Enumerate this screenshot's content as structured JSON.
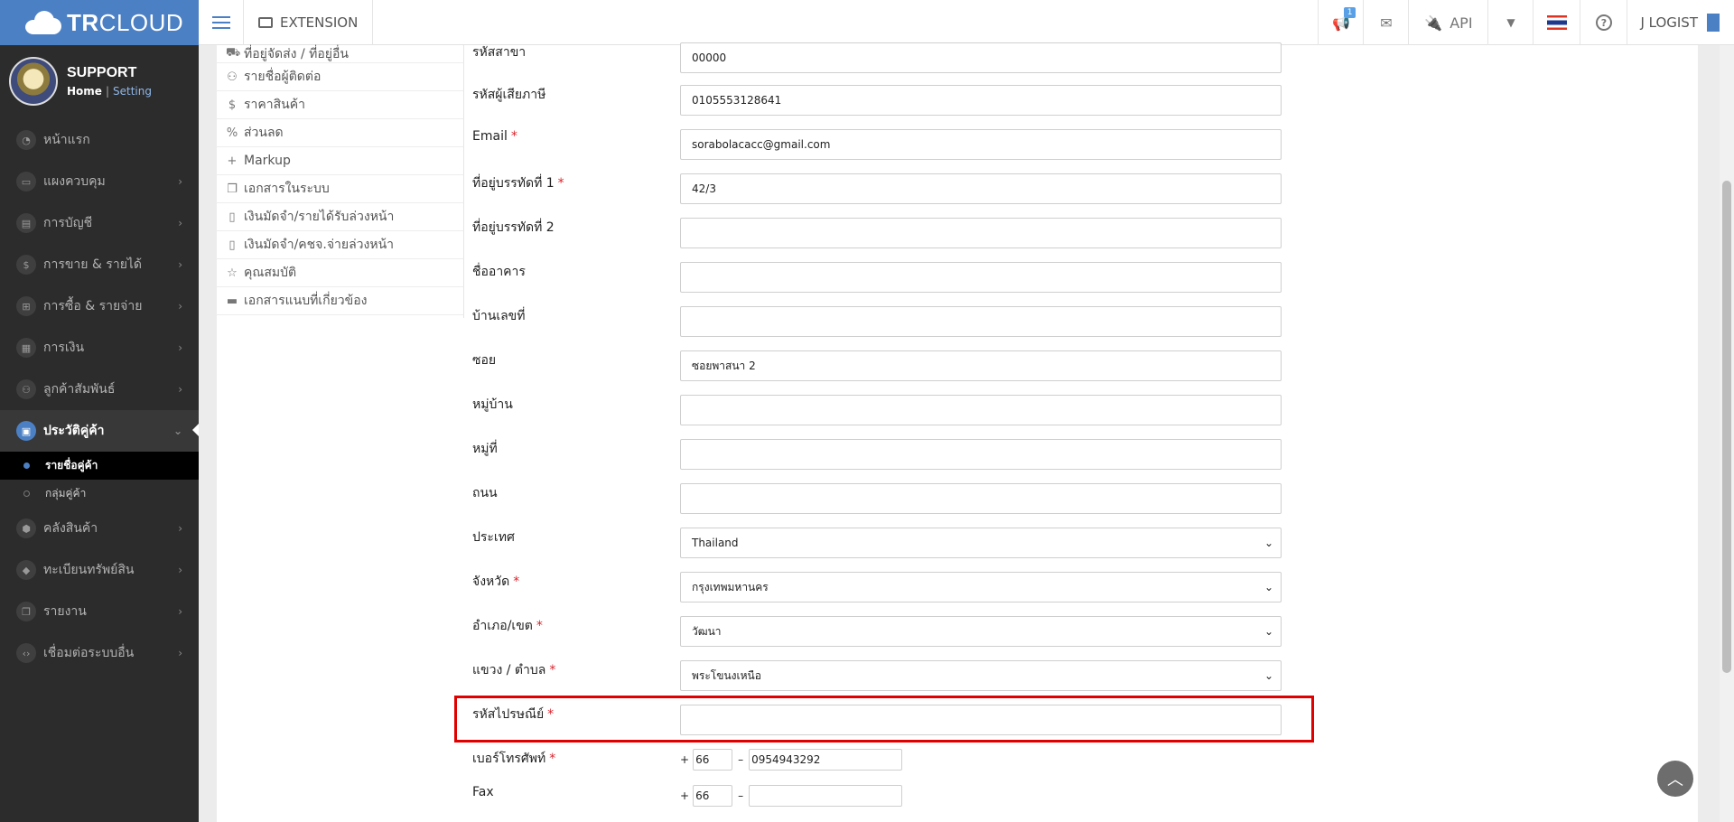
{
  "brand": {
    "bold": "TR",
    "light": "CLOUD"
  },
  "profile": {
    "name": "SUPPORT",
    "home": "Home",
    "separator": "|",
    "setting": "Setting"
  },
  "sidebar": {
    "items": [
      {
        "label": "หน้าแรก",
        "icon": "dashboard-icon",
        "glyph": "◔"
      },
      {
        "label": "แผงควบคุม",
        "icon": "monitor-icon",
        "glyph": "▭"
      },
      {
        "label": "การบัญชี",
        "icon": "book-icon",
        "glyph": "▤"
      },
      {
        "label": "การขาย & รายได้",
        "icon": "dollar-icon",
        "glyph": "$"
      },
      {
        "label": "การซื้อ & รายจ่าย",
        "icon": "cart-icon",
        "glyph": "⊞"
      },
      {
        "label": "การเงิน",
        "icon": "calendar-icon",
        "glyph": "▦"
      },
      {
        "label": "ลูกค้าสัมพันธ์",
        "icon": "users-icon",
        "glyph": "⚇"
      },
      {
        "label": "ประวัติคู่ค้า",
        "icon": "contact-card-icon",
        "glyph": "▣"
      },
      {
        "label": "คลังสินค้า",
        "icon": "cubes-icon",
        "glyph": "⬢"
      },
      {
        "label": "ทะเบียนทรัพย์สิน",
        "icon": "diamond-icon",
        "glyph": "◆"
      },
      {
        "label": "รายงาน",
        "icon": "copy-icon",
        "glyph": "❐"
      },
      {
        "label": "เชื่อมต่อระบบอื่น",
        "icon": "code-icon",
        "glyph": "‹›"
      }
    ],
    "sub_items": [
      {
        "label": "รายชื่อคู่ค้า"
      },
      {
        "label": "กลุ่มคู่ค้า"
      }
    ]
  },
  "topbar": {
    "extension": "EXTENSION",
    "notification_count": "1",
    "api": "API",
    "company": "J LOGIST"
  },
  "subnav": {
    "items": [
      {
        "label": "ที่อยู่จัดส่ง / ที่อยู่อื่น",
        "icon": "truck-icon",
        "glyph": "⛟"
      },
      {
        "label": "รายชื่อผู้ติดต่อ",
        "icon": "users-icon",
        "glyph": "⚇"
      },
      {
        "label": "ราคาสินค้า",
        "icon": "dollar-icon",
        "glyph": "$"
      },
      {
        "label": "ส่วนลด",
        "icon": "percent-icon",
        "glyph": "%"
      },
      {
        "label": "Markup",
        "icon": "plus-icon",
        "glyph": "+"
      },
      {
        "label": "เอกสารในระบบ",
        "icon": "copy-icon",
        "glyph": "❐"
      },
      {
        "label": "เงินมัดจำ/รายได้รับล่วงหน้า",
        "icon": "file-icon",
        "glyph": "▯"
      },
      {
        "label": "เงินมัดจำ/คชจ.จ่ายล่วงหน้า",
        "icon": "file-icon",
        "glyph": "▯"
      },
      {
        "label": "คุณสมบัติ",
        "icon": "star-icon",
        "glyph": "☆"
      },
      {
        "label": "เอกสารแนบที่เกี่ยวข้อง",
        "icon": "folder-icon",
        "glyph": "▬"
      }
    ]
  },
  "form": {
    "branch_code": {
      "label": "รหัสสาขา",
      "value": "00000"
    },
    "tax_id": {
      "label": "รหัสผู้เสียภาษี",
      "value": "0105553128641"
    },
    "email": {
      "label": "Email",
      "value": "sorabolacacc@gmail.com"
    },
    "address1": {
      "label": "ที่อยู่บรรทัดที่ 1",
      "value": "42/3"
    },
    "address2": {
      "label": "ที่อยู่บรรทัดที่ 2",
      "value": ""
    },
    "building": {
      "label": "ชื่ออาคาร",
      "value": ""
    },
    "house_no": {
      "label": "บ้านเลขที่",
      "value": ""
    },
    "soi": {
      "label": "ซอย",
      "value": "ซอยพาสนา 2"
    },
    "village": {
      "label": "หมู่บ้าน",
      "value": ""
    },
    "moo": {
      "label": "หมู่ที่",
      "value": ""
    },
    "road": {
      "label": "ถนน",
      "value": ""
    },
    "country": {
      "label": "ประเทศ",
      "value": "Thailand"
    },
    "province": {
      "label": "จังหวัด",
      "value": "กรุงเทพมหานคร"
    },
    "district": {
      "label": "อำเภอ/เขต",
      "value": "วัฒนา"
    },
    "subdistrict": {
      "label": "แขวง / ตำบล",
      "value": "พระโขนงเหนือ"
    },
    "postcode": {
      "label": "รหัสไปรษณีย์",
      "value": ""
    },
    "phone": {
      "label": "เบอร์โทรศัพท์",
      "prefix": "+",
      "country_code": "66",
      "dash": "–",
      "number": "0954943292"
    },
    "fax": {
      "label": "Fax",
      "prefix": "+",
      "country_code": "66",
      "dash": "–",
      "number": ""
    },
    "required_mark": "*"
  }
}
